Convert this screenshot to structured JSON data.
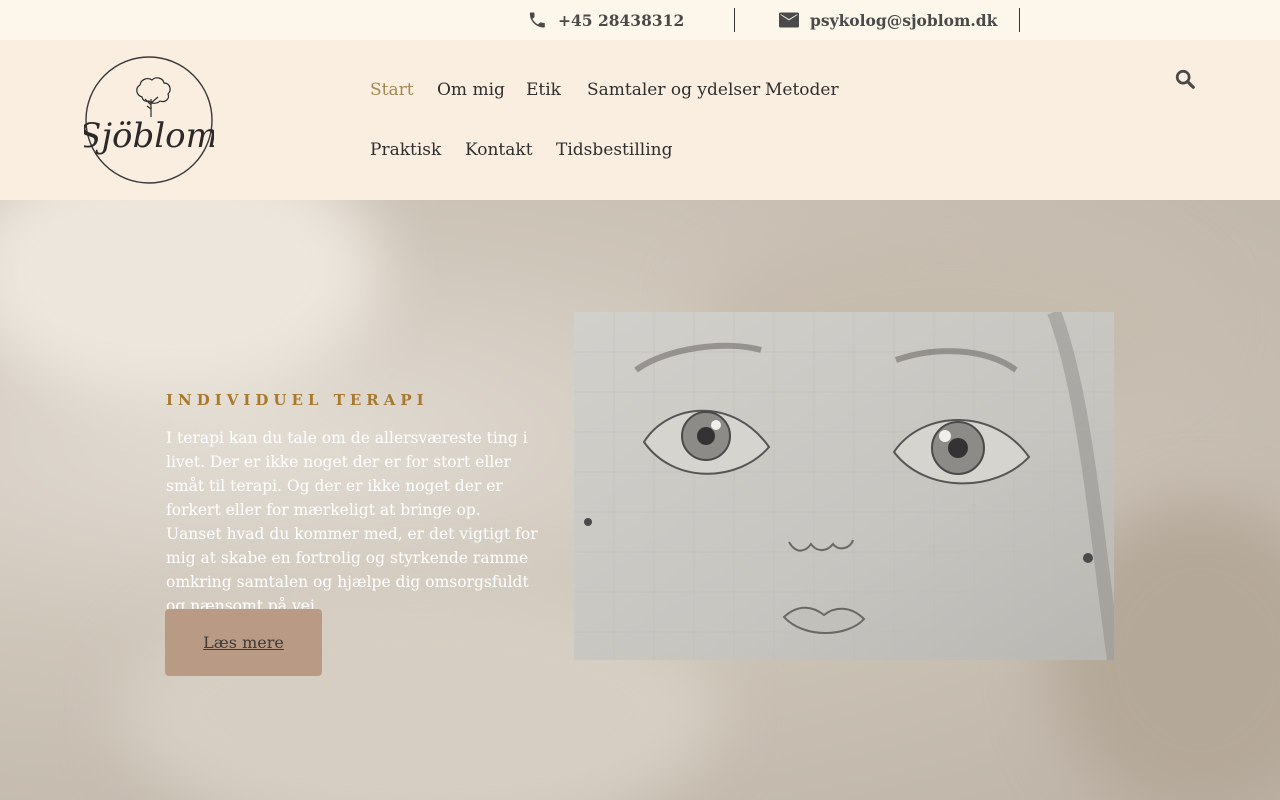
{
  "topbar": {
    "phone_icon": "phone-icon",
    "phone": "+45 28438312",
    "email_icon": "envelope-icon",
    "email": "psykolog@sjoblom.dk"
  },
  "logo": {
    "text": "Sjöblom",
    "icon": "tree-icon"
  },
  "nav": {
    "items": [
      {
        "label": "Start",
        "active": true
      },
      {
        "label": "Om mig"
      },
      {
        "label": "Etik"
      },
      {
        "label": "Samtaler og ydelser"
      },
      {
        "label": "Metoder"
      },
      {
        "label": "Praktisk"
      },
      {
        "label": "Kontakt"
      },
      {
        "label": "Tidsbestilling"
      }
    ],
    "search_icon": "search-icon"
  },
  "hero": {
    "title": "INDIVIDUEL TERAPI",
    "text": "I terapi kan du tale om de allersværeste ting i livet. Der er ikke noget der er for stort eller småt til terapi. Og der er ikke noget der er forkert eller for mærkeligt at bringe op. Uanset hvad du kommer med, er det vigtigt for mig at skabe en fortrolig og styrkende ramme omkring samtalen og hjælpe dig omsorgsfuldt og nænsomt på vej.",
    "button": "Læs mere",
    "image": "pencil-sketch-face"
  },
  "colors": {
    "accent_gold": "#a8792e",
    "nav_active": "#a4864f",
    "header_bg": "#faeee0",
    "topbar_bg": "#fdf6ea",
    "button_bg": "#b99b85"
  }
}
